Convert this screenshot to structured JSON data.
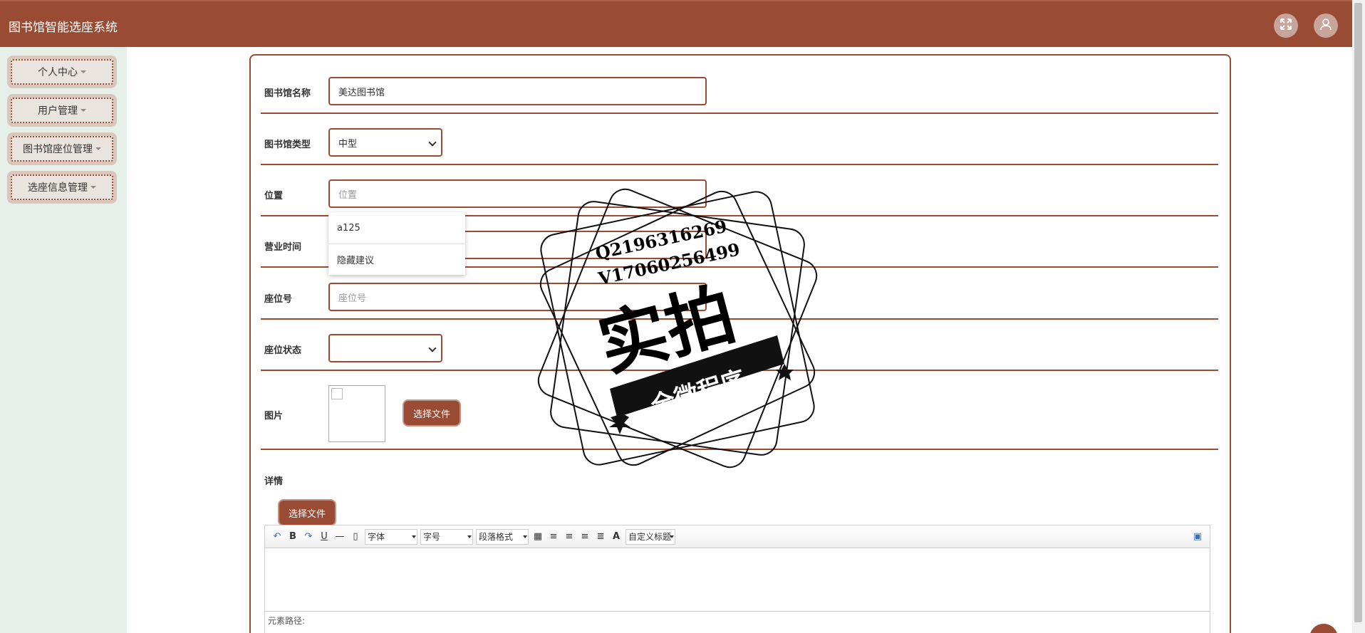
{
  "header": {
    "title": "图书馆智能选座系统",
    "fullscreen_icon": "fullscreen-icon",
    "user_icon": "user-avatar-icon"
  },
  "sidebar": {
    "items": [
      {
        "label": "个人中心"
      },
      {
        "label": "用户管理"
      },
      {
        "label": "图书馆座位管理"
      },
      {
        "label": "选座信息管理"
      }
    ]
  },
  "form": {
    "library_name": {
      "label": "图书馆名称",
      "value": "美达图书馆"
    },
    "library_type": {
      "label": "图书馆类型",
      "value": "中型"
    },
    "location": {
      "label": "位置",
      "placeholder": "位置"
    },
    "autocomplete": [
      "a125",
      "隐藏建议"
    ],
    "opening_hours": {
      "label": "营业时间"
    },
    "seat_number": {
      "label": "座位号",
      "placeholder": "座位号"
    },
    "seat_status": {
      "label": "座位状态",
      "value": ""
    },
    "image": {
      "label": "图片",
      "button": "选择文件"
    },
    "details": {
      "label": "详情",
      "button": "选择文件"
    }
  },
  "editor": {
    "font_combo": "字体",
    "size_combo": "字号",
    "paragraph_combo": "段落格式",
    "custom_title_combo": "自定义标题",
    "text_color_icon": "A",
    "bold": "B",
    "underline": "U",
    "status": "元素路径:"
  },
  "watermark": {
    "line1": "Q2196316269",
    "line2": "V17060256499",
    "big": "实拍",
    "banner": "全微程序"
  },
  "colors": {
    "primary": "#9a4b34",
    "sidebar_bg": "#e7efe9"
  }
}
